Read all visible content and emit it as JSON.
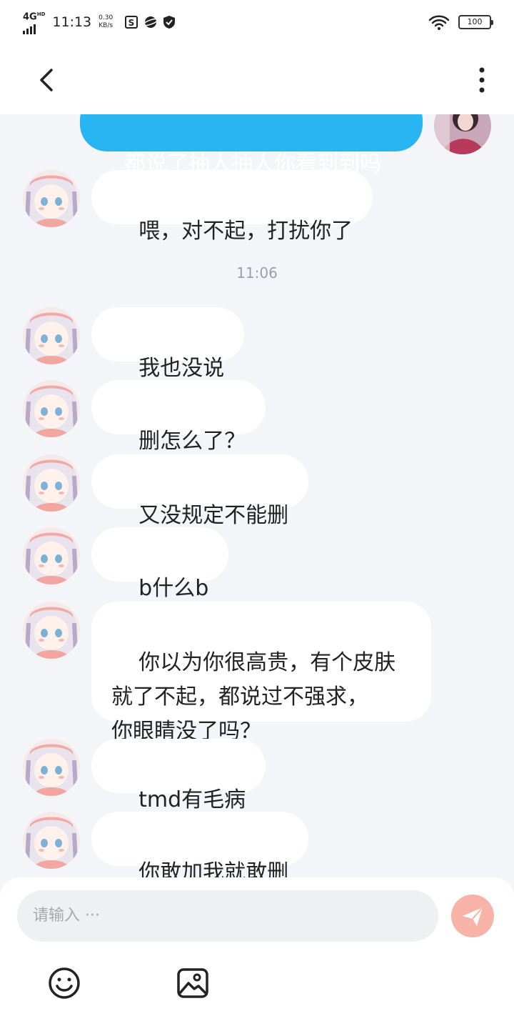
{
  "status_bar": {
    "network": "4G",
    "network_sup": "HD",
    "time": "11:13",
    "speed_value": "0.30",
    "speed_unit": "KB/s",
    "battery": "100",
    "icons": [
      "sim-icon",
      "planet-icon",
      "shield-icon",
      "wifi-icon",
      "battery-icon"
    ]
  },
  "header": {
    "back_icon": "chevron-left-icon",
    "more_icon": "more-vertical-icon"
  },
  "messages": [
    {
      "side": "right",
      "text": "都说了抽人抽人你看到到吗"
    },
    {
      "side": "left",
      "text": "喂，对不起，打扰你了"
    },
    {
      "side": "left",
      "text": "我也没说"
    },
    {
      "side": "left",
      "text": "删怎么了？"
    },
    {
      "side": "left",
      "text": "又没规定不能删"
    },
    {
      "side": "left",
      "text": "b什么b"
    },
    {
      "side": "left",
      "text": "你以为你很高贵，有个皮肤\n就了不起，都说过不强求，\n你眼睛没了吗？"
    },
    {
      "side": "left",
      "text": "tmd有毛病"
    },
    {
      "side": "left",
      "text": "你敢加我就敢删"
    }
  ],
  "timestamp": "11:06",
  "composer": {
    "placeholder": "请输入 ···",
    "send_icon": "paper-plane-icon",
    "emoji_icon": "smiley-icon",
    "image_icon": "image-icon"
  },
  "colors": {
    "my_bubble": "#29b4f2",
    "other_bubble": "#ffffff",
    "background": "#f3f5f8",
    "send_button": "#f7b3a8"
  }
}
